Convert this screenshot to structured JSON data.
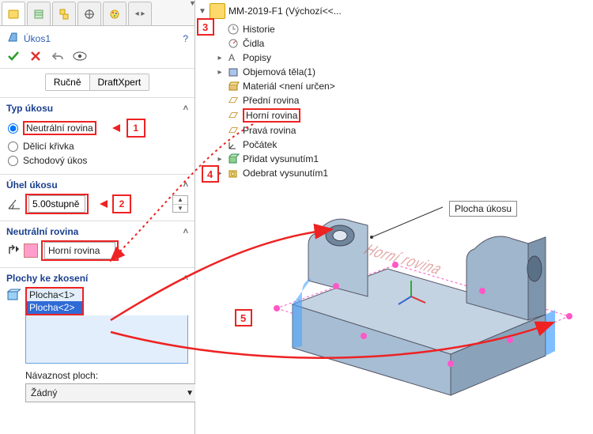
{
  "tree": {
    "root": "MM-2019-F1  (Výchozí<<...",
    "items": {
      "history": "Historie",
      "sensors": "Čidla",
      "annotations": "Popisy",
      "solid_bodies": "Objemová těla(1)",
      "material": "Materiál <není určen>",
      "front_plane": "Přední rovina",
      "top_plane": "Horní rovina",
      "right_plane": "Pravá rovina",
      "origin": "Počátek",
      "boss_extrude": "Přidat vysunutím1",
      "cut_extrude": "Odebrat vysunutím1"
    }
  },
  "feature": {
    "title": "Úkos1",
    "help_icon": "?",
    "mode_manual": "Ručně",
    "mode_draftxpert": "DraftXpert"
  },
  "sections": {
    "type": {
      "title": "Typ úkosu",
      "opt_neutral": "Neutrální rovina",
      "opt_parting": "Dělicí křivka",
      "opt_step": "Schodový úkos"
    },
    "angle": {
      "title": "Úhel úkosu",
      "value": "5.00stupně"
    },
    "neutral_plane": {
      "title": "Neutrální rovina",
      "value": "Horní rovina"
    },
    "faces": {
      "title": "Plochy ke zkosení",
      "item1": "Plocha<1>",
      "item2": "Plocha<2>",
      "continuity_label": "Návaznost ploch:",
      "continuity_value": "Žádný"
    }
  },
  "viewport": {
    "face_label": "Plocha úkosu",
    "plane_text": "Horní rovina"
  },
  "callouts": {
    "c1": "1",
    "c2": "2",
    "c3": "3",
    "c4": "4",
    "c5": "5"
  }
}
